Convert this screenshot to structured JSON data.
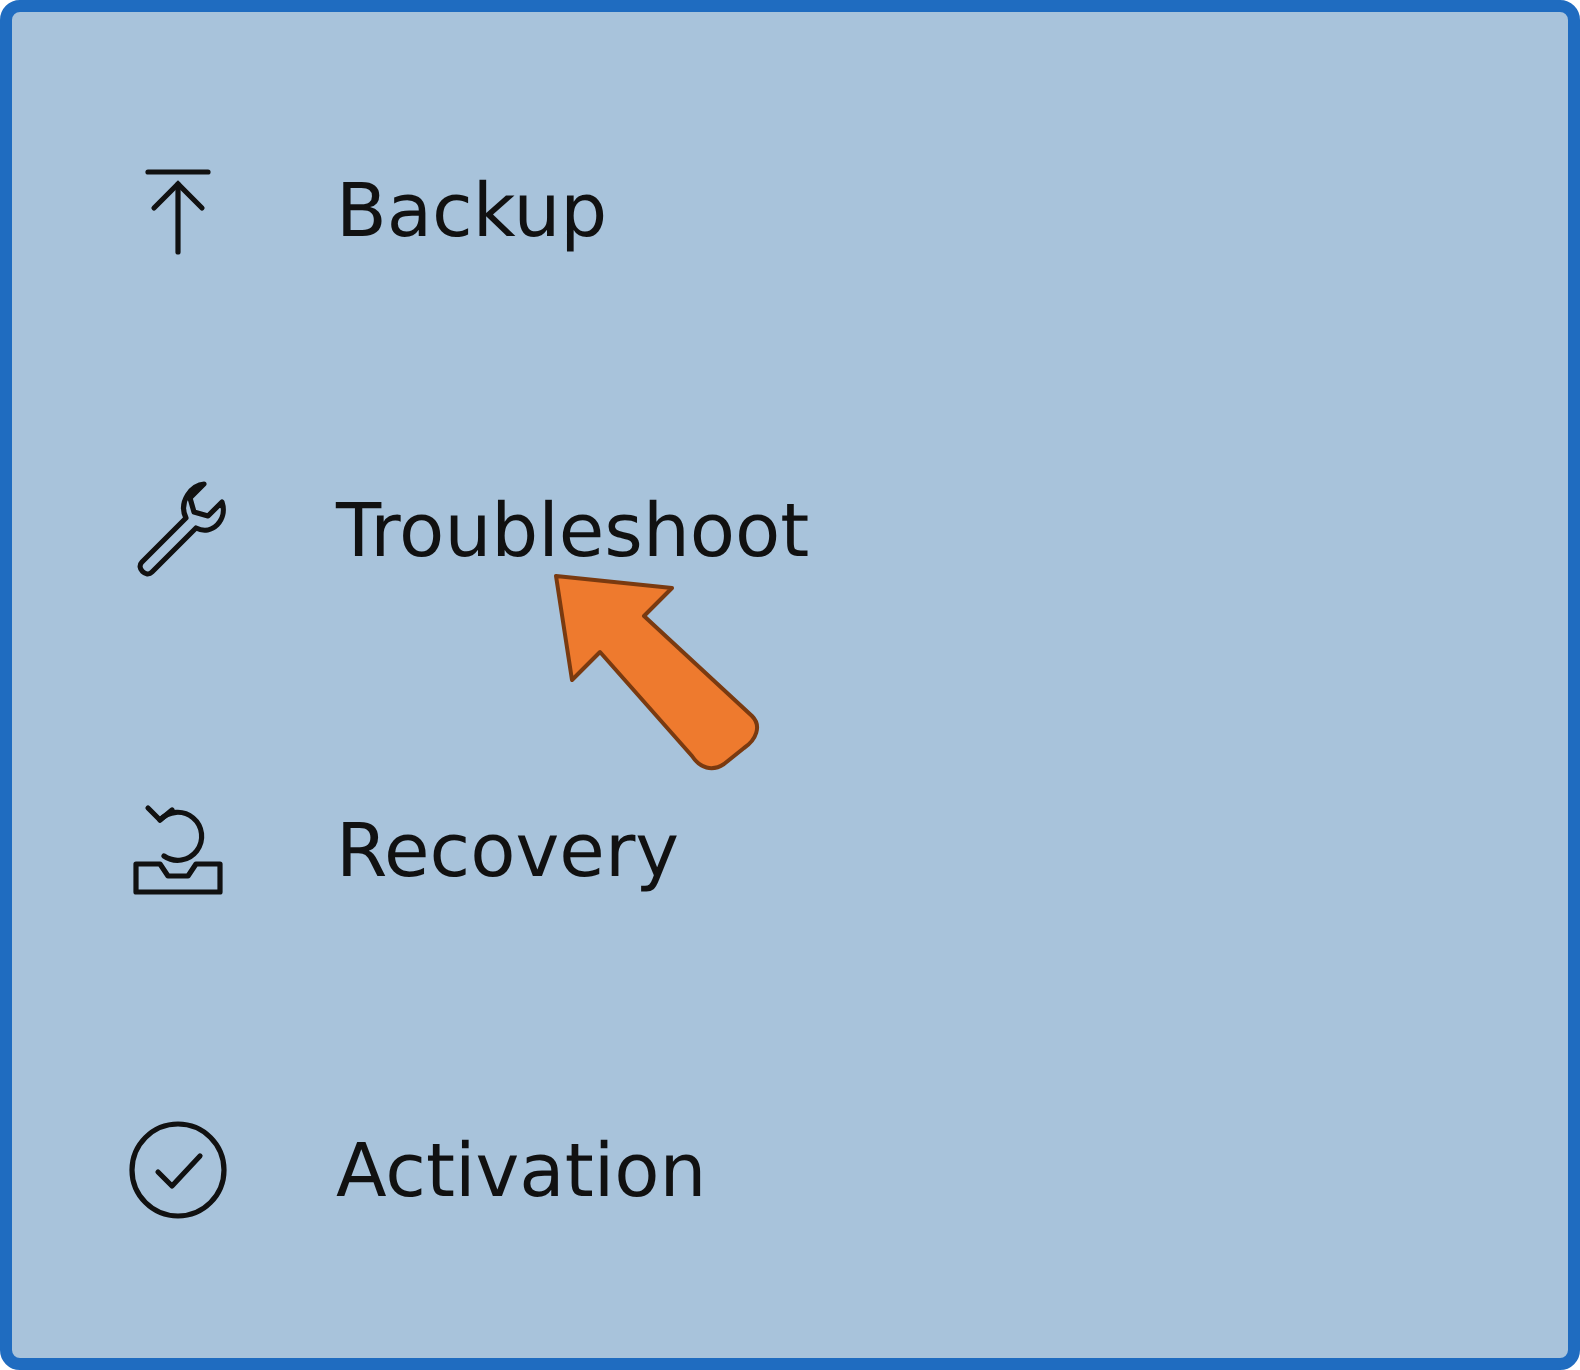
{
  "menu": {
    "items": [
      {
        "kind": "backup",
        "label": "Backup"
      },
      {
        "kind": "troubleshoot",
        "label": "Troubleshoot"
      },
      {
        "kind": "recovery",
        "label": "Recovery"
      },
      {
        "kind": "activation",
        "label": "Activation"
      }
    ]
  },
  "annotation": {
    "kind": "arrow"
  }
}
